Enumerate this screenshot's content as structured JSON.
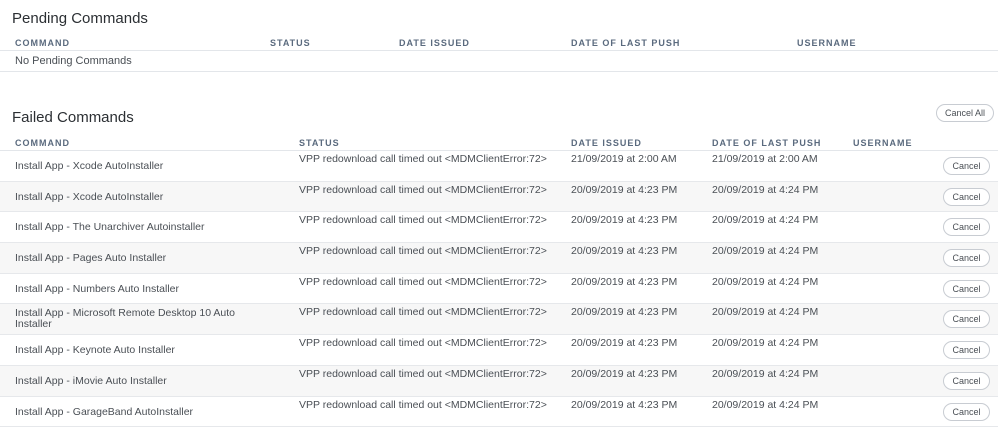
{
  "pending": {
    "title": "Pending Commands",
    "headers": {
      "command": "COMMAND",
      "status": "STATUS",
      "date_issued": "DATE ISSUED",
      "date_last_push": "DATE OF LAST PUSH",
      "username": "USERNAME"
    },
    "empty_text": "No Pending Commands"
  },
  "failed": {
    "title": "Failed Commands",
    "cancel_all_label": "Cancel All",
    "headers": {
      "command": "COMMAND",
      "status": "STATUS",
      "date_issued": "DATE ISSUED",
      "date_last_push": "DATE OF LAST PUSH",
      "username": "USERNAME"
    },
    "rows": [
      {
        "command": "Install App - Xcode AutoInstaller",
        "status": "VPP redownload call timed out <MDMClientError:72>",
        "date_issued": "21/09/2019 at 2:00 AM",
        "date_last_push": "21/09/2019 at 2:00 AM",
        "username": "",
        "cancel_label": "Cancel"
      },
      {
        "command": "Install App - Xcode AutoInstaller",
        "status": "VPP redownload call timed out <MDMClientError:72>",
        "date_issued": "20/09/2019 at 4:23 PM",
        "date_last_push": "20/09/2019 at 4:24 PM",
        "username": "",
        "cancel_label": "Cancel"
      },
      {
        "command": "Install App - The Unarchiver Autoinstaller",
        "status": "VPP redownload call timed out <MDMClientError:72>",
        "date_issued": "20/09/2019 at 4:23 PM",
        "date_last_push": "20/09/2019 at 4:24 PM",
        "username": "",
        "cancel_label": "Cancel"
      },
      {
        "command": "Install App - Pages Auto Installer",
        "status": "VPP redownload call timed out <MDMClientError:72>",
        "date_issued": "20/09/2019 at 4:23 PM",
        "date_last_push": "20/09/2019 at 4:24 PM",
        "username": "",
        "cancel_label": "Cancel"
      },
      {
        "command": "Install App - Numbers Auto Installer",
        "status": "VPP redownload call timed out <MDMClientError:72>",
        "date_issued": "20/09/2019 at 4:23 PM",
        "date_last_push": "20/09/2019 at 4:24 PM",
        "username": "",
        "cancel_label": "Cancel"
      },
      {
        "command": "Install App - Microsoft Remote Desktop 10 Auto Installer",
        "status": "VPP redownload call timed out <MDMClientError:72>",
        "date_issued": "20/09/2019 at 4:23 PM",
        "date_last_push": "20/09/2019 at 4:24 PM",
        "username": "",
        "cancel_label": "Cancel"
      },
      {
        "command": "Install App - Keynote Auto Installer",
        "status": "VPP redownload call timed out <MDMClientError:72>",
        "date_issued": "20/09/2019 at 4:23 PM",
        "date_last_push": "20/09/2019 at 4:24 PM",
        "username": "",
        "cancel_label": "Cancel"
      },
      {
        "command": "Install App - iMovie Auto Installer",
        "status": "VPP redownload call timed out <MDMClientError:72>",
        "date_issued": "20/09/2019 at 4:23 PM",
        "date_last_push": "20/09/2019 at 4:24 PM",
        "username": "",
        "cancel_label": "Cancel"
      },
      {
        "command": "Install App - GarageBand AutoInstaller",
        "status": "VPP redownload call timed out <MDMClientError:72>",
        "date_issued": "20/09/2019 at 4:23 PM",
        "date_last_push": "20/09/2019 at 4:24 PM",
        "username": "",
        "cancel_label": "Cancel"
      }
    ]
  }
}
